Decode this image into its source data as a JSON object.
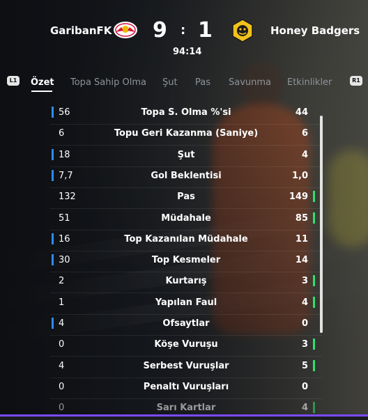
{
  "match": {
    "home_team": "GaribanFK",
    "away_team": "Honey Badgers",
    "home_score": "9",
    "separator": ":",
    "away_score": "1",
    "clock": "94:14"
  },
  "tabs": {
    "left_shoulder": "L1",
    "right_shoulder": "R1",
    "items": [
      "Özet",
      "Topa Sahip Olma",
      "Şut",
      "Pas",
      "Savunma",
      "Etkinlikler"
    ],
    "active": "Özet"
  },
  "colors": {
    "home_accent": "#2b8cff",
    "away_accent": "#2fe06b"
  },
  "stats": [
    {
      "label": "Topa S. Olma %'si",
      "home": "56",
      "away": "44",
      "leader": "home"
    },
    {
      "label": "Topu Geri Kazanma (Saniye)",
      "home": "6",
      "away": "6",
      "leader": "none"
    },
    {
      "label": "Şut",
      "home": "18",
      "away": "4",
      "leader": "home"
    },
    {
      "label": "Gol Beklentisi",
      "home": "7,7",
      "away": "1,0",
      "leader": "home"
    },
    {
      "label": "Pas",
      "home": "132",
      "away": "149",
      "leader": "away"
    },
    {
      "label": "Müdahale",
      "home": "51",
      "away": "85",
      "leader": "away"
    },
    {
      "label": "Top Kazanılan Müdahale",
      "home": "16",
      "away": "11",
      "leader": "home"
    },
    {
      "label": "Top Kesmeler",
      "home": "30",
      "away": "14",
      "leader": "home"
    },
    {
      "label": "Kurtarış",
      "home": "2",
      "away": "3",
      "leader": "away"
    },
    {
      "label": "Yapılan Faul",
      "home": "1",
      "away": "4",
      "leader": "away"
    },
    {
      "label": "Ofsaytlar",
      "home": "4",
      "away": "0",
      "leader": "home"
    },
    {
      "label": "Köşe Vuruşu",
      "home": "0",
      "away": "3",
      "leader": "away"
    },
    {
      "label": "Serbest Vuruşlar",
      "home": "4",
      "away": "5",
      "leader": "away"
    },
    {
      "label": "Penaltı Vuruşları",
      "home": "0",
      "away": "0",
      "leader": "none"
    },
    {
      "label": "Sarı Kartlar",
      "home": "0",
      "away": "4",
      "leader": "away"
    }
  ]
}
